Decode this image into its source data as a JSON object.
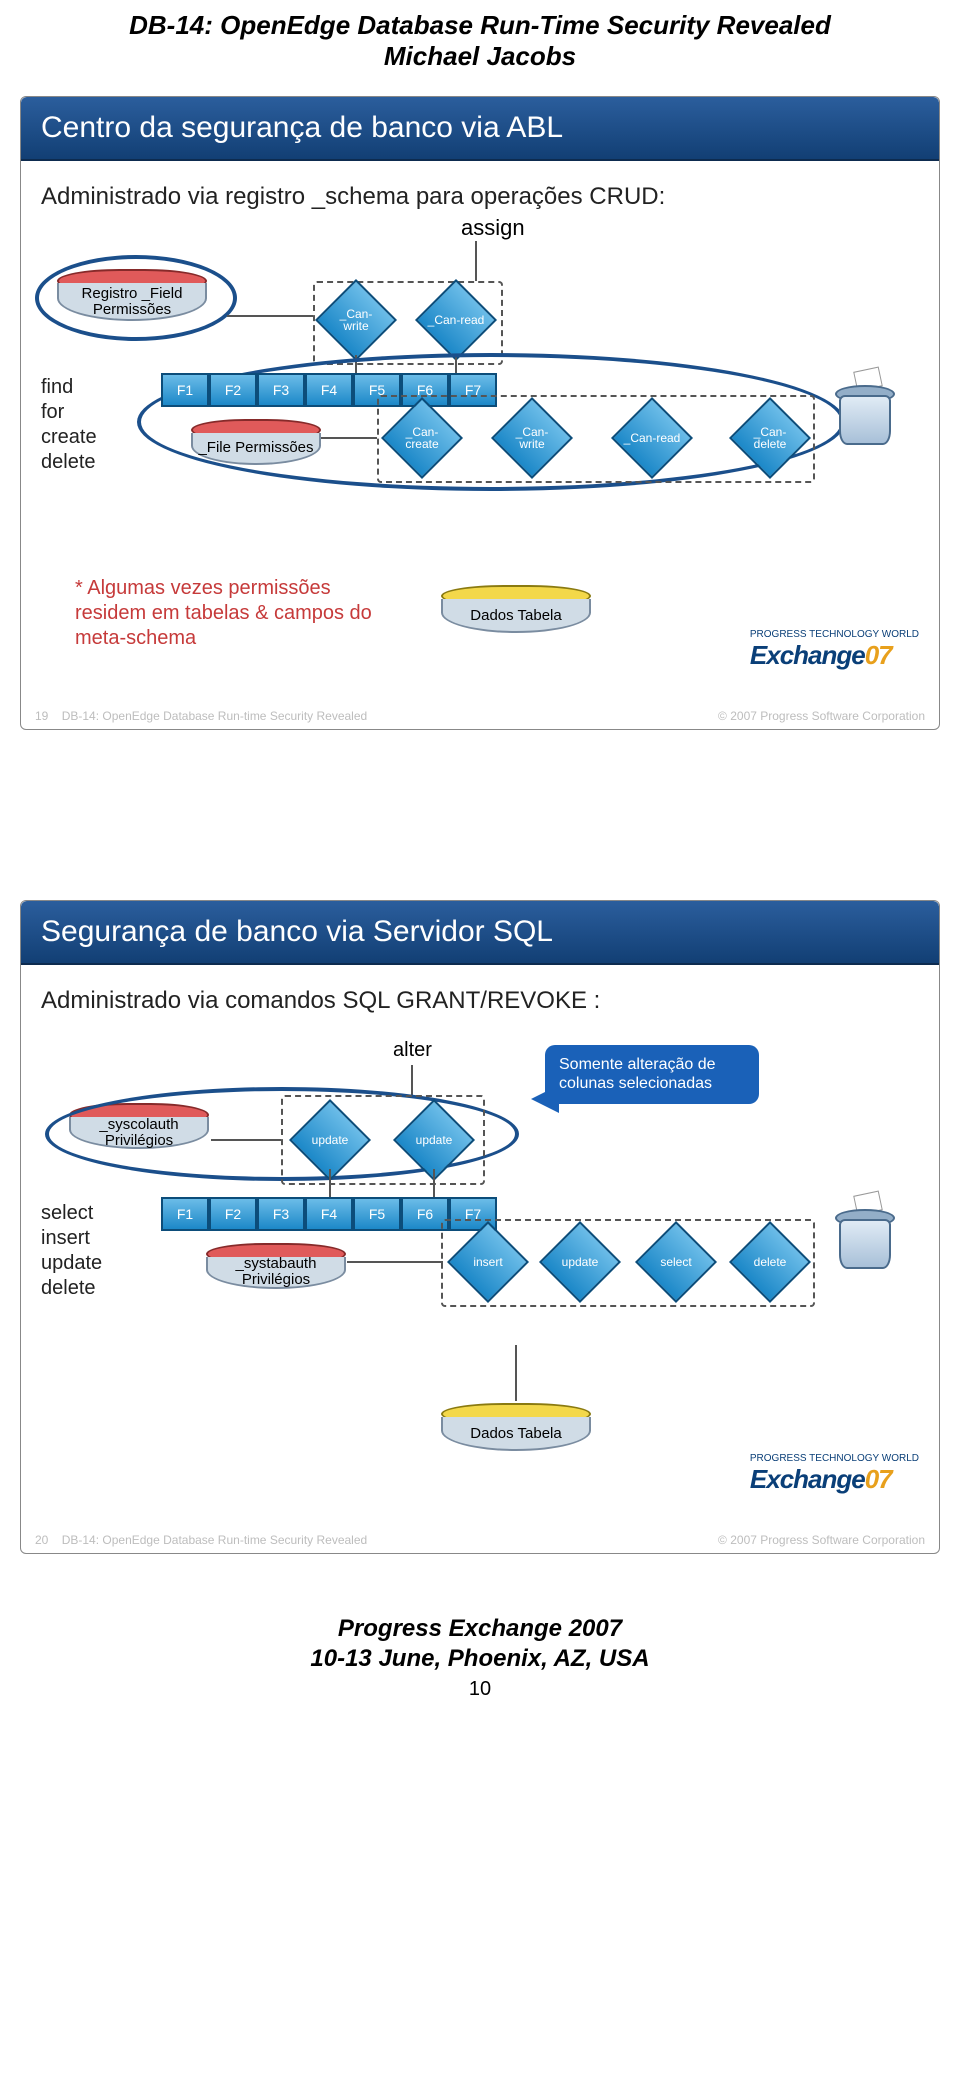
{
  "doc": {
    "title": "DB-14: OpenEdge Database Run-Time Security Revealed",
    "author": "Michael Jacobs"
  },
  "slide1": {
    "header": "Centro da segurança de banco via ABL",
    "subtitle": "Administrado via registro _schema para operações CRUD:",
    "assign": "assign",
    "registro_field": "Registro _Field Permissões",
    "can_write": "_Can-write",
    "can_read": "_Can-read",
    "verbs": [
      "find",
      "for",
      "create",
      "delete"
    ],
    "f_cols": [
      "F1",
      "F2",
      "F3",
      "F4",
      "F5",
      "F6",
      "F7"
    ],
    "file_perm": "_File Permissões",
    "d_create": "_Can-create",
    "d_write": "_Can-write",
    "d_read": "_Can-read",
    "d_delete": "_Can-delete",
    "note": "* Algumas vezes permissões residem em tabelas & campos do meta-schema",
    "dados": "Dados Tabela",
    "logo_top": "PROGRESS TECHNOLOGY WORLD",
    "logo_big": "Exchange",
    "logo_seven": "07",
    "foot_num": "19",
    "foot_left": "DB-14: OpenEdge Database Run-time Security Revealed",
    "foot_right": "© 2007 Progress Software Corporation"
  },
  "slide2": {
    "header": "Segurança de banco via Servidor SQL",
    "subtitle": "Administrado via comandos SQL GRANT/REVOKE :",
    "alter": "alter",
    "callout": "Somente alteração de colunas selecionadas",
    "syscol": "_syscolauth Privilégios",
    "upd1": "update",
    "upd2": "update",
    "verbs": [
      "select",
      "insert",
      "update",
      "delete"
    ],
    "f_cols": [
      "F1",
      "F2",
      "F3",
      "F4",
      "F5",
      "F6",
      "F7"
    ],
    "systab": "_systabauth Privilégios",
    "d_insert": "insert",
    "d_update": "update",
    "d_select": "select",
    "d_delete": "delete",
    "dados": "Dados Tabela",
    "foot_num": "20",
    "foot_left": "DB-14: OpenEdge Database Run-time Security Revealed",
    "foot_right": "© 2007 Progress Software Corporation"
  },
  "footer": {
    "line1": "Progress Exchange 2007",
    "line2": "10-13 June, Phoenix, AZ, USA",
    "page": "10"
  }
}
